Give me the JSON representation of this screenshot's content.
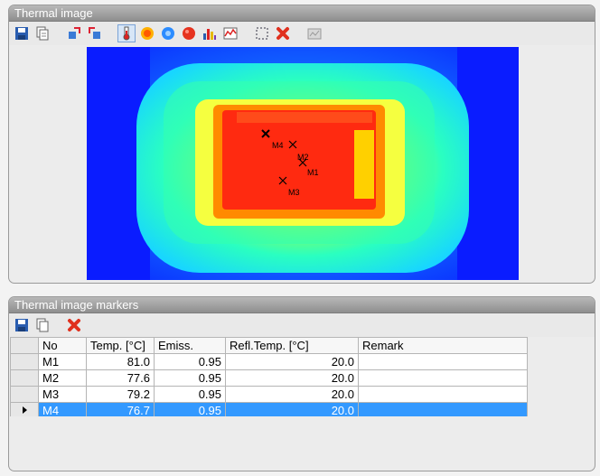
{
  "thermal_panel": {
    "title": "Thermal image",
    "toolbar": [
      {
        "name": "save-icon"
      },
      {
        "name": "copy-icon"
      },
      {
        "name": "rotate-left-icon"
      },
      {
        "name": "rotate-right-icon"
      },
      {
        "name": "thermometer-icon",
        "active": true
      },
      {
        "name": "palette-iron-icon"
      },
      {
        "name": "palette-rainbow-icon"
      },
      {
        "name": "palette-red-icon"
      },
      {
        "name": "histogram-icon"
      },
      {
        "name": "profile-icon"
      },
      {
        "name": "select-area-icon"
      },
      {
        "name": "delete-icon"
      },
      {
        "name": "export-icon"
      }
    ],
    "markers_on_image": [
      "M4",
      "M2",
      "M1",
      "M3"
    ]
  },
  "markers_panel": {
    "title": "Thermal image markers",
    "toolbar": [
      {
        "name": "save-icon"
      },
      {
        "name": "copy-icon"
      },
      {
        "name": "delete-icon"
      }
    ],
    "columns": [
      "No",
      "Temp. [°C]",
      "Emiss.",
      "Refl.Temp. [°C]",
      "Remark"
    ],
    "rows": [
      {
        "no": "M1",
        "temp": "81.0",
        "emiss": "0.95",
        "refl": "20.0",
        "remark": "",
        "selected": false
      },
      {
        "no": "M2",
        "temp": "77.6",
        "emiss": "0.95",
        "refl": "20.0",
        "remark": "",
        "selected": false
      },
      {
        "no": "M3",
        "temp": "79.2",
        "emiss": "0.95",
        "refl": "20.0",
        "remark": "",
        "selected": false
      },
      {
        "no": "M4",
        "temp": "76.7",
        "emiss": "0.95",
        "refl": "20.0",
        "remark": "",
        "selected": true
      }
    ],
    "selection_color": "#3399ff"
  }
}
